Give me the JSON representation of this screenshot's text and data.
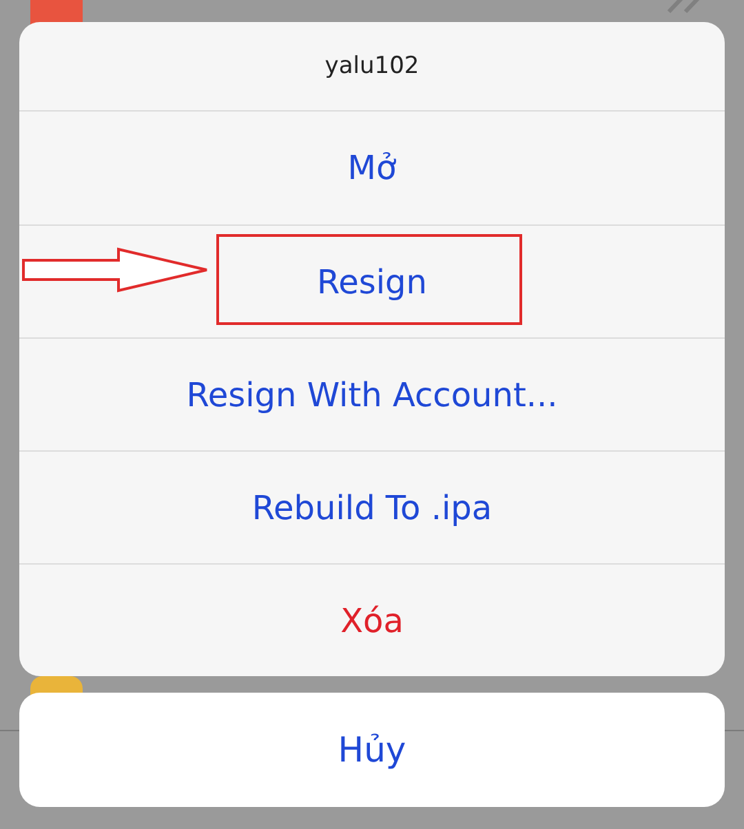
{
  "action_sheet": {
    "title": "yalu102",
    "actions": [
      {
        "label": "Mở",
        "destructive": false,
        "highlighted": false
      },
      {
        "label": "Resign",
        "destructive": false,
        "highlighted": true
      },
      {
        "label": "Resign With Account...",
        "destructive": false,
        "highlighted": false
      },
      {
        "label": "Rebuild To .ipa",
        "destructive": false,
        "highlighted": false
      },
      {
        "label": "Xóa",
        "destructive": true,
        "highlighted": false
      }
    ],
    "cancel": "Hủy"
  }
}
